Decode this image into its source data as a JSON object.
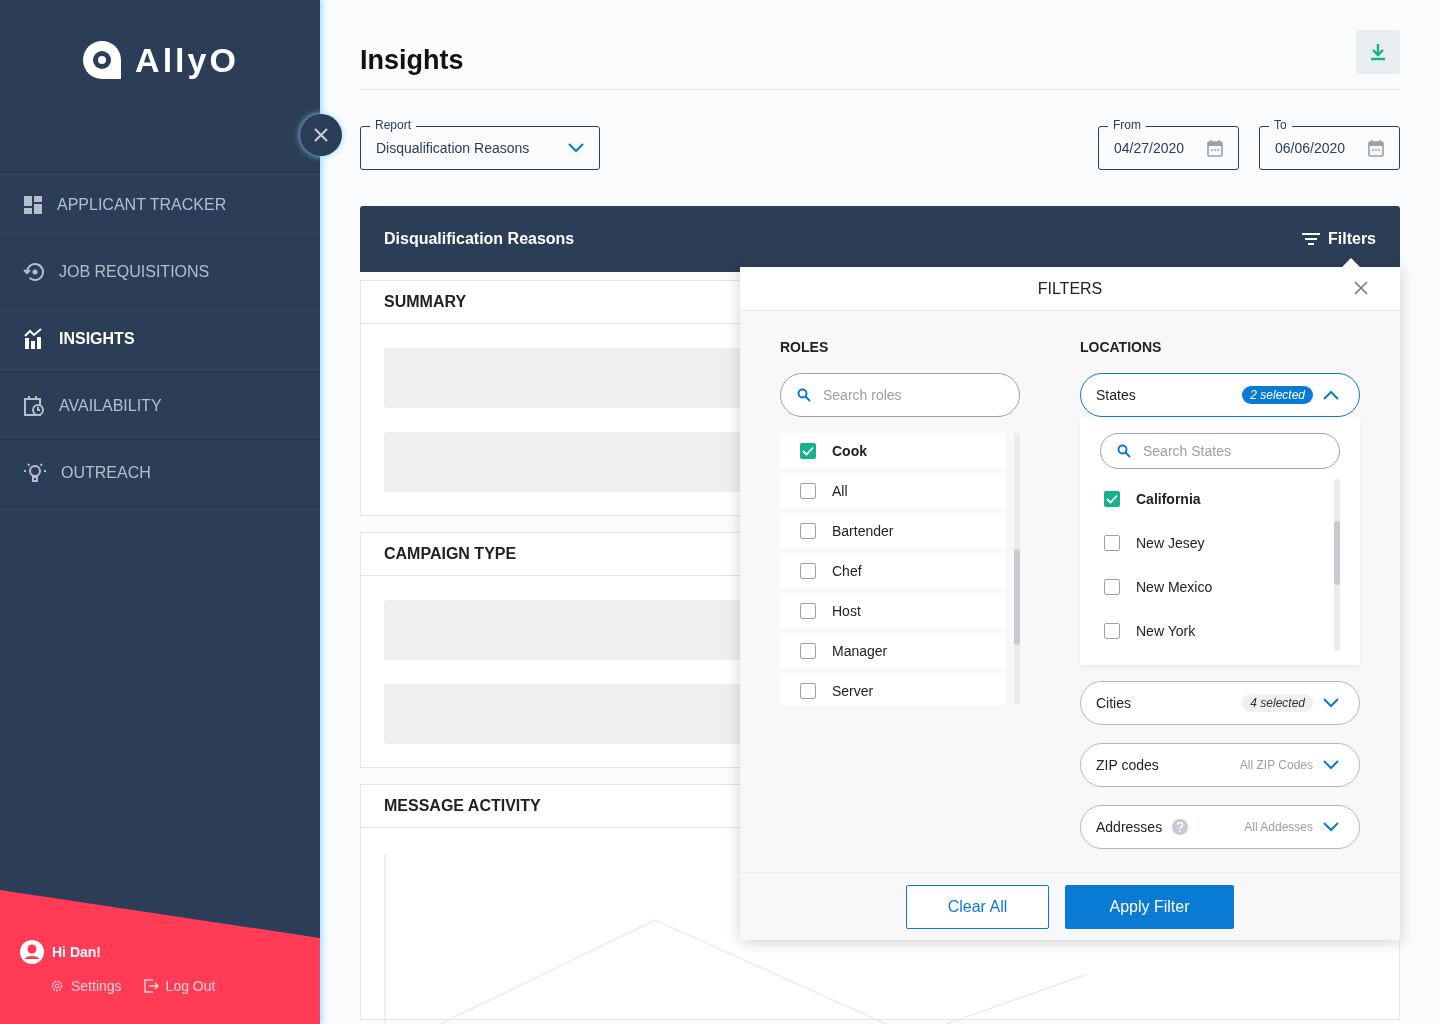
{
  "sidebar": {
    "logo": "AllyO",
    "items": [
      {
        "label": "APPLICANT TRACKER",
        "selected": false
      },
      {
        "label": "JOB REQUISITIONS",
        "selected": false
      },
      {
        "label": "INSIGHTS",
        "selected": true
      },
      {
        "label": "AVAILABILITY",
        "selected": false
      },
      {
        "label": "OUTREACH",
        "selected": false
      }
    ],
    "user": {
      "greeting": "Hi Dan!",
      "links": [
        "Settings",
        "Log Out"
      ]
    }
  },
  "page": {
    "title": "Insights",
    "report": {
      "label": "Report",
      "value": "Disqualification Reasons"
    },
    "from": {
      "label": "From",
      "value": "04/27/2020"
    },
    "to": {
      "label": "To",
      "value": "06/06/2020"
    },
    "header": {
      "title": "Disqualification Reasons",
      "filters_button": "Filters"
    },
    "cards": [
      {
        "title": "SUMMARY",
        "kind": "blocks"
      },
      {
        "title": "CAMPAIGN TYPE",
        "kind": "blocks"
      },
      {
        "title": "MESSAGE ACTIVITY",
        "kind": "chart"
      }
    ]
  },
  "filters": {
    "title": "FILTERS",
    "roles": {
      "title": "ROLES",
      "placeholder": "Search roles",
      "items": [
        {
          "label": "Cook",
          "checked": true
        },
        {
          "label": "All",
          "checked": false
        },
        {
          "label": "Bartender",
          "checked": false
        },
        {
          "label": "Chef",
          "checked": false
        },
        {
          "label": "Host",
          "checked": false
        },
        {
          "label": "Manager",
          "checked": false
        },
        {
          "label": "Server",
          "checked": false
        }
      ]
    },
    "locations": {
      "title": "LOCATIONS",
      "dropdowns": [
        {
          "label": "States",
          "summary": "2 selected",
          "kind": "count",
          "expanded": true,
          "placeholder": "Search States",
          "items": [
            {
              "label": "California",
              "checked": true
            },
            {
              "label": "New Jesey",
              "checked": false
            },
            {
              "label": "New Mexico",
              "checked": false
            },
            {
              "label": "New York",
              "checked": false
            }
          ]
        },
        {
          "label": "Cities",
          "summary": "4 selected",
          "kind": "count",
          "expanded": false
        },
        {
          "label": "ZIP codes",
          "summary": "All ZIP Codes",
          "kind": "all",
          "expanded": false
        },
        {
          "label": "Addresses",
          "summary": "All Addesses",
          "kind": "all",
          "expanded": false,
          "help": true
        }
      ]
    },
    "buttons": {
      "clear": "Clear All",
      "apply": "Apply Filter"
    }
  }
}
